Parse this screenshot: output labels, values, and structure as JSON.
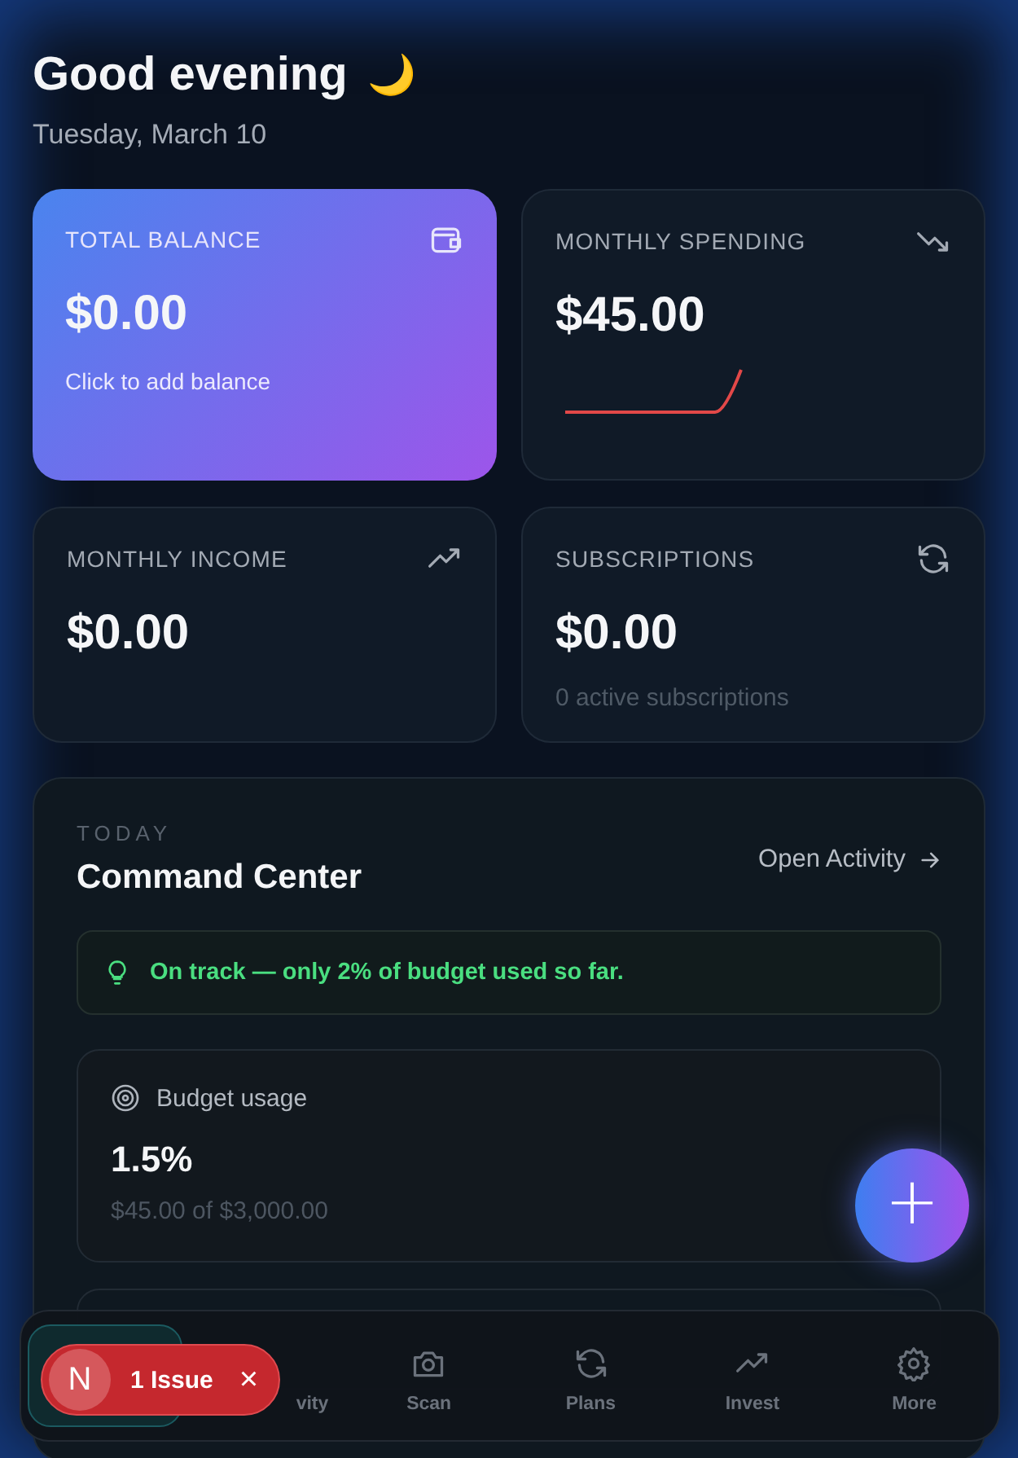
{
  "header": {
    "greeting": "Good evening",
    "emoji": "🌙",
    "date": "Tuesday, March 10"
  },
  "cards": [
    {
      "kind": "balance",
      "title": "TOTAL BALANCE",
      "value": "$0.00",
      "note": "Click to add balance"
    },
    {
      "kind": "spending",
      "title": "MONTHLY SPENDING",
      "value": "$45.00"
    },
    {
      "kind": "income",
      "title": "MONTHLY INCOME",
      "value": "$0.00"
    },
    {
      "kind": "subscriptions",
      "title": "SUBSCRIPTIONS",
      "value": "$0.00",
      "note": "0 active subscriptions"
    }
  ],
  "command_center": {
    "eyebrow": "TODAY",
    "title": "Command Center",
    "link": "Open Activity",
    "tip": "On track — only 2% of budget used so far.",
    "budget": {
      "label": "Budget usage",
      "value": "1.5%",
      "detail": "$45.00 of $3,000.00"
    }
  },
  "fab": {
    "symbol": "+"
  },
  "nav": [
    {
      "selected": true
    },
    {
      "label": "vity",
      "selected": false
    },
    {
      "label": "Scan",
      "selected": false
    },
    {
      "label": "Plans",
      "selected": false
    },
    {
      "label": "Invest",
      "selected": false
    },
    {
      "label": "More",
      "selected": false
    }
  ],
  "issue_badge": {
    "letter": "N",
    "text": "1 Issue",
    "close": "×"
  }
}
